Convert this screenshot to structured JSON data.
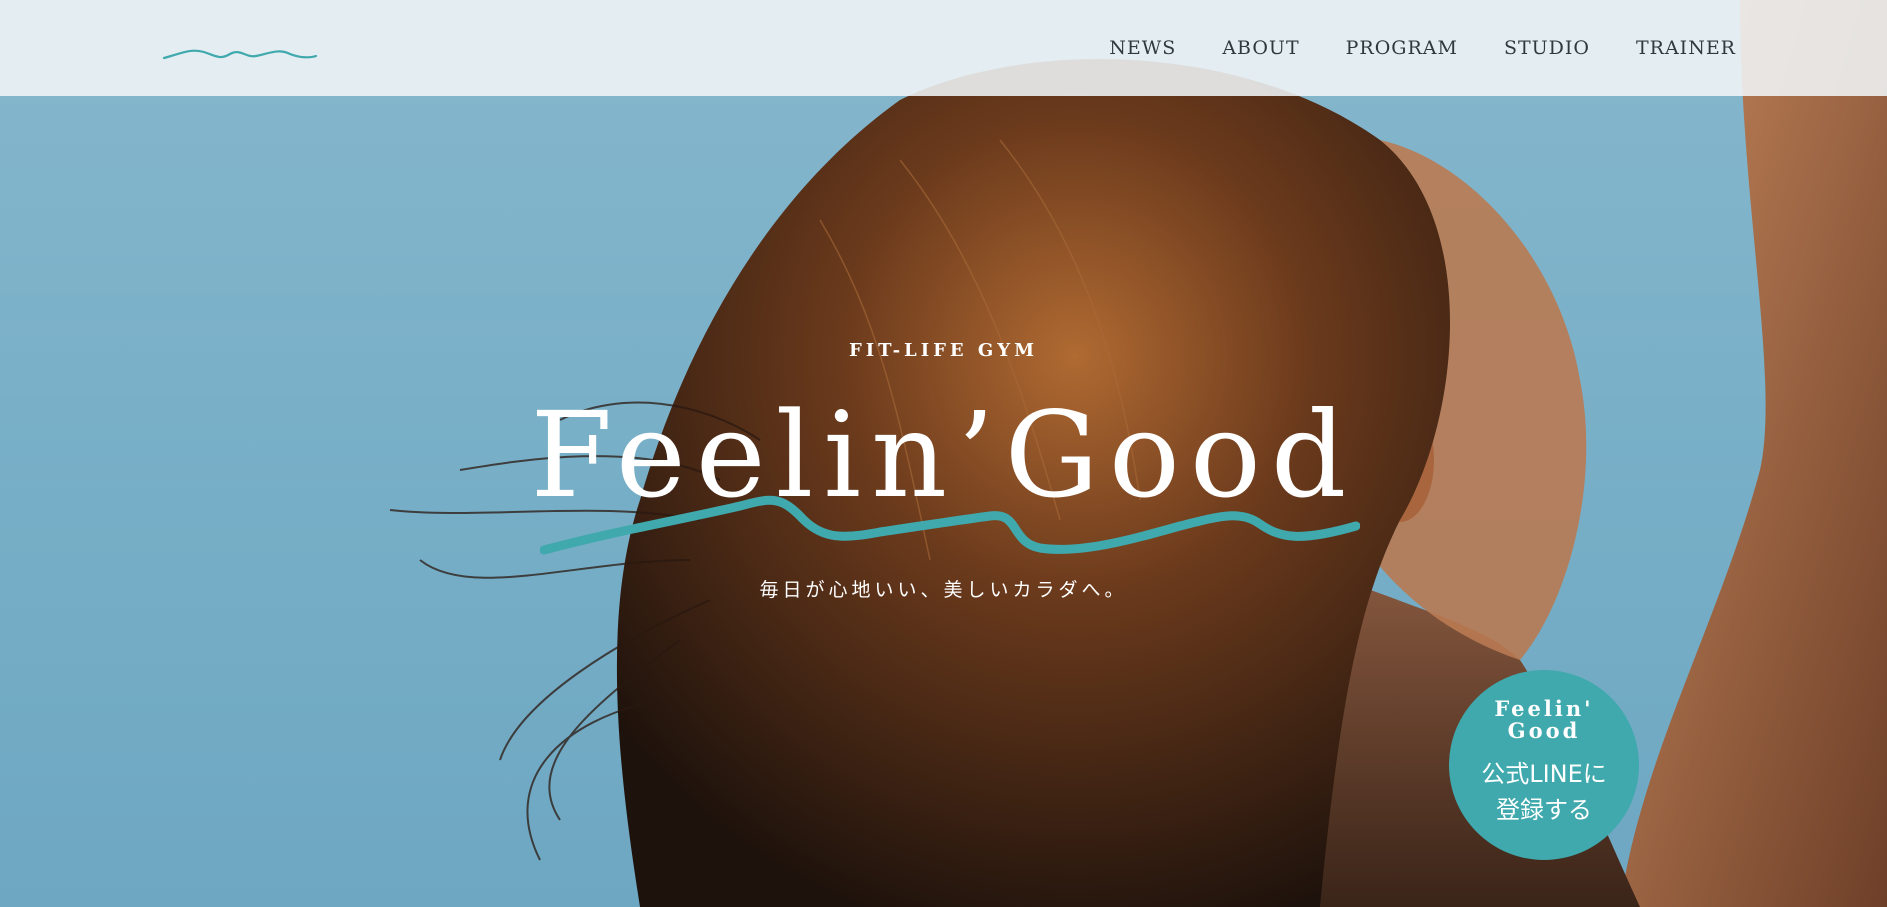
{
  "nav": {
    "items": [
      {
        "label": "NEWS"
      },
      {
        "label": "ABOUT"
      },
      {
        "label": "PROGRAM"
      },
      {
        "label": "STUDIO"
      },
      {
        "label": "TRAINER"
      }
    ]
  },
  "hero": {
    "eyebrow": "FIT-LIFE GYM",
    "title": "Feelin’Good",
    "tagline": "毎日が心地いい、美しいカラダへ。"
  },
  "line_badge": {
    "brand_line1": "Feelin'",
    "brand_line2": "Good",
    "cta_line1": "公式LINEに",
    "cta_line2": "登録する"
  },
  "colors": {
    "accent": "#3fa9ad",
    "header_bg": "#f0f5f7",
    "nav_text": "#2e3a3e",
    "sky": "#7fb3c9"
  },
  "icons": {
    "logo": "wave-logo-icon",
    "title_decoration": "wave-underline-icon"
  }
}
